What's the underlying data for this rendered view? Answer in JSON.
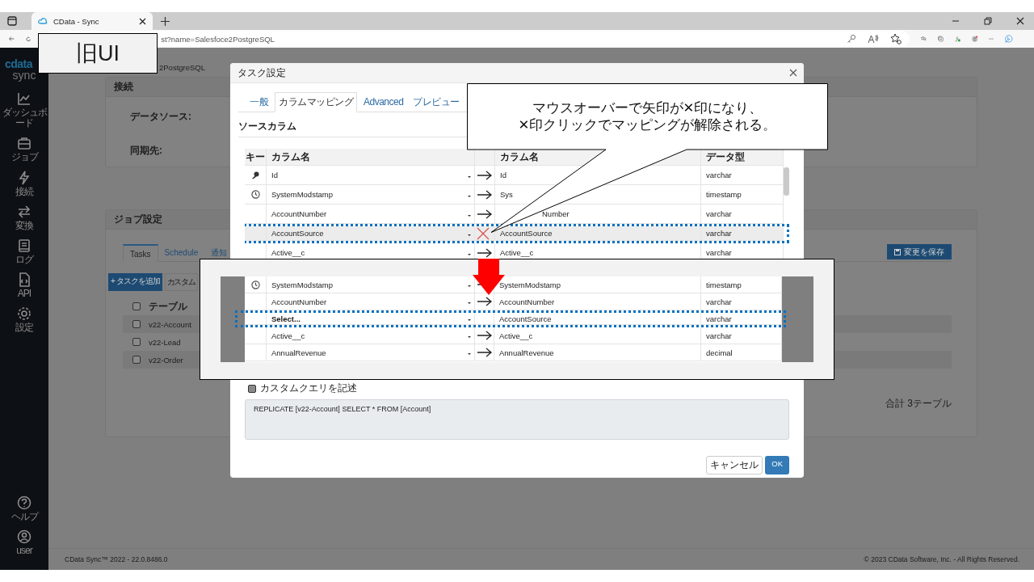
{
  "browser": {
    "tab_title": "CData - Sync",
    "url": "st?name=Salesfoce2PostgreSQL"
  },
  "label_box": "旧UI",
  "sidebar": {
    "logo": "cdata",
    "product": "sync",
    "items": [
      {
        "kind": "chart",
        "label": "ダッシュボード"
      },
      {
        "kind": "briefcase",
        "label": "ジョブ"
      },
      {
        "kind": "bolt",
        "label": "接続"
      },
      {
        "kind": "swap",
        "label": "変換"
      },
      {
        "kind": "book",
        "label": "ログ"
      },
      {
        "kind": "file",
        "label": "API"
      },
      {
        "kind": "gear",
        "label": "設定"
      }
    ],
    "bottom_items": [
      {
        "kind": "help",
        "label": "ヘルプ"
      },
      {
        "kind": "user",
        "label": "user"
      }
    ]
  },
  "page": {
    "breadcrumb": "2PostgreSQL",
    "connection": {
      "title": "接続",
      "fields": [
        "データソース:",
        "同期先:"
      ]
    },
    "job": {
      "title": "ジョブ設定",
      "tabs": [
        {
          "label": "Tasks",
          "selected": true
        },
        {
          "label": "Schedule",
          "selected": false
        },
        {
          "label": "通知",
          "selected": false
        }
      ],
      "save_button": "変更を保存",
      "add_button": "+ タスクを追加",
      "custom_button": "カスタム",
      "table_header": "テーブル",
      "header_checked": false,
      "rows": [
        {
          "name": "v22-Account",
          "checked": false
        },
        {
          "name": "v22-Lead",
          "checked": false
        },
        {
          "name": "v22-Order",
          "checked": false
        }
      ],
      "total": "合計 3テーブル"
    }
  },
  "modal": {
    "title": "タスク設定",
    "tabs": [
      {
        "label": "一般",
        "selected": false
      },
      {
        "label": "カラムマッピング",
        "selected": true
      },
      {
        "label": "Advanced",
        "selected": false
      },
      {
        "label": "プレビュー",
        "selected": false
      }
    ],
    "section": "ソースカラム",
    "columns": [
      "キー",
      "カラム名",
      "カラム名",
      "データ型"
    ],
    "rows": [
      {
        "kind": "mapped",
        "key": true,
        "stamp": false,
        "source": "Id",
        "target": "Id",
        "type": "varchar",
        "hovered": false,
        "marked": false,
        "unset": false,
        "target_behind_callout": false
      },
      {
        "kind": "mapped",
        "key": false,
        "stamp": true,
        "source": "SystemModstamp",
        "target": "Sys",
        "type": "timestamp",
        "hovered": false,
        "marked": false,
        "unset": false,
        "target_behind_callout": false
      },
      {
        "kind": "mapped",
        "key": false,
        "stamp": false,
        "source": "AccountNumber",
        "target": "Number",
        "type": "varchar",
        "hovered": false,
        "marked": false,
        "unset": false,
        "target_behind_callout": true
      },
      {
        "kind": "unmapping",
        "key": false,
        "stamp": false,
        "source": "AccountSource",
        "target": "AccountSource",
        "type": "varchar",
        "hovered": true,
        "marked": true,
        "unset": false,
        "target_behind_callout": false
      },
      {
        "kind": "mapped",
        "key": false,
        "stamp": false,
        "source": "Active__c",
        "target": "Active__c",
        "type": "varchar",
        "hovered": false,
        "marked": false,
        "unset": false,
        "target_behind_callout": false
      }
    ],
    "custom_query": {
      "label": "カスタムクエリを記述",
      "checked": false
    },
    "query": "REPLICATE [v22-Account] SELECT * FROM [Account]",
    "cancel_button": "キャンセル",
    "ok_button": "OK"
  },
  "callout": {
    "lines": [
      "マウスオーバーで矢印が✕印になり、",
      "✕印クリックでマッピングが解除される。"
    ]
  },
  "inset": {
    "rows": [
      {
        "kind": "mapped",
        "key": false,
        "stamp": true,
        "source": "SystemModstamp",
        "target": "SystemModstamp",
        "type": "timestamp",
        "hovered": false,
        "marked": false,
        "unset": false
      },
      {
        "kind": "mapped",
        "key": false,
        "stamp": false,
        "source": "AccountNumber",
        "target": "AccountNumber",
        "type": "varchar",
        "hovered": false,
        "marked": false,
        "unset": false
      },
      {
        "kind": "unmapped",
        "key": false,
        "stamp": false,
        "source": "Select...",
        "target": "AccountSource",
        "type": "varchar",
        "hovered": false,
        "marked": true,
        "unset": true
      },
      {
        "kind": "mapped",
        "key": false,
        "stamp": false,
        "source": "Active__c",
        "target": "Active__c",
        "type": "varchar",
        "hovered": false,
        "marked": false,
        "unset": false
      },
      {
        "kind": "mapped",
        "key": false,
        "stamp": false,
        "source": "AnnualRevenue",
        "target": "AnnualRevenue",
        "type": "decimal",
        "hovered": false,
        "marked": false,
        "unset": false
      }
    ]
  },
  "footer": {
    "version": "CData Sync™ 2022 - 22.0.8486.0",
    "copyright": "© 2023 CData Software, Inc. - All Rights Reserved."
  }
}
